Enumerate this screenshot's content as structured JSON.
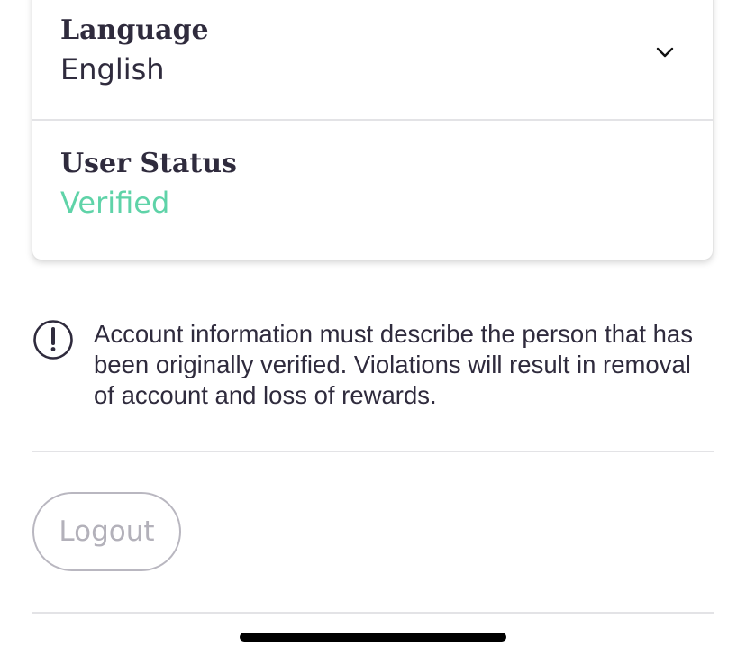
{
  "settings": {
    "language": {
      "title": "Language",
      "value": "English",
      "icon": "chevron-down-icon"
    },
    "user_status": {
      "title": "User Status",
      "value": "Verified",
      "value_color": "#5fd3a8"
    }
  },
  "notice": {
    "icon": "exclamation-circle-icon",
    "text": "Account information must describe the person that has been originally verified. Violations will result in removal of account and loss of rewards."
  },
  "logout": {
    "label": "Logout"
  },
  "colors": {
    "text": "#2f2b3d",
    "verified": "#5fd3a8",
    "muted_border": "#b9b7c0",
    "divider": "#e3e3e6"
  }
}
